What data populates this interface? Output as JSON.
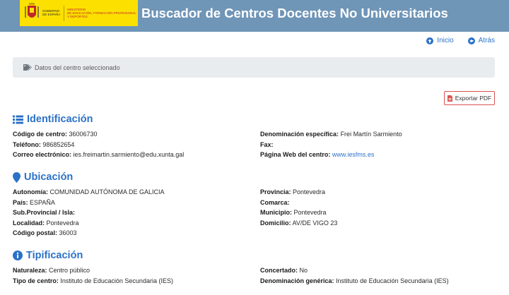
{
  "header": {
    "logo": {
      "gov_lines": [
        "GOBIERNO",
        "DE ESPAÑA"
      ],
      "ministry_lines": [
        "MINISTERIO",
        "DE EDUCACIÓN, FORMACIÓN PROFESIONAL",
        "Y DEPORTES"
      ]
    },
    "title": "Buscador de Centros Docentes No Universitarios"
  },
  "nav": {
    "home": "Inicio",
    "back": "Atrás"
  },
  "selected_bar": "Datos del centro seleccionado",
  "export_pdf": "Exportar PDF",
  "identificacion": {
    "title": "Identificación",
    "codigo_label": "Código de centro:",
    "codigo": "36006730",
    "telefono_label": "Teléfono:",
    "telefono": "986852654",
    "correo_label": "Correo electrónico:",
    "correo": "ies.freimartin.sarmiento@edu.xunta.gal",
    "denominacion_label": "Denominación específica:",
    "denominacion": "Frei Martín Sarmiento",
    "fax_label": "Fax:",
    "fax": "",
    "web_label": "Página Web del centro:",
    "web": "www.iesfms.es"
  },
  "ubicacion": {
    "title": "Ubicación",
    "autonomia_label": "Autonomía:",
    "autonomia": "COMUNIDAD AUTÓNOMA DE GALICIA",
    "pais_label": "País:",
    "pais": "ESPAÑA",
    "subprovincial_label": "Sub.Provincial / Isla:",
    "subprovincial": "",
    "localidad_label": "Localidad:",
    "localidad": "Pontevedra",
    "cp_label": "Código postal:",
    "cp": "36003",
    "provincia_label": "Provincia:",
    "provincia": "Pontevedra",
    "comarca_label": "Comarca:",
    "comarca": "",
    "municipio_label": "Municipio:",
    "municipio": "Pontevedra",
    "domicilio_label": "Domicilio:",
    "domicilio": "AV/DE VIGO 23"
  },
  "tipificacion": {
    "title": "Tipificación",
    "naturaleza_label": "Naturaleza:",
    "naturaleza": "Centro público",
    "tipo_label": "Tipo de centro:",
    "tipo": "Instituto de Educación Secundaria (IES)",
    "concertado_label": "Concertado:",
    "concertado": "No",
    "denom_generica_label": "Denominación genérica:",
    "denom_generica": "Instituto de Educación Secundaria (IES)"
  },
  "colors": {
    "header": "#6f95b7",
    "logo_bg": "#fce100",
    "accent": "#2b72c7",
    "bar_bg": "#e9ecef",
    "pdf_border": "#d9534f"
  },
  "icons": [
    "home-icon",
    "back-arrow-icon",
    "tag-icon",
    "pdf-icon",
    "list-icon",
    "map-marker-icon",
    "info-icon",
    "spain-coat-of-arms-icon"
  ]
}
